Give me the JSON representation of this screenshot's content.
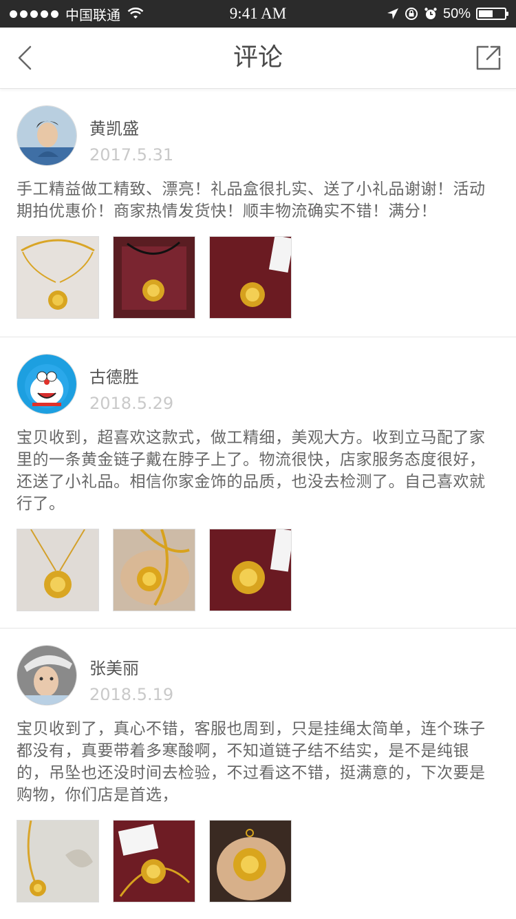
{
  "status_bar": {
    "carrier": "中国联通",
    "time": "9:41 AM",
    "battery": "50%",
    "battery_level": 0.5
  },
  "nav": {
    "title": "评论"
  },
  "reviews": [
    {
      "name": "黄凯盛",
      "date": "2017.5.31",
      "text": "手工精益做工精致、漂亮！礼品盒很扎实、送了小礼品谢谢！活动期拍优惠价！商家热情发货快！顺丰物流确实不错！满分！",
      "photos": [
        "gold-bangle-pendant",
        "pendant-in-gift-box",
        "pendant-with-tag"
      ]
    },
    {
      "name": "古德胜",
      "date": "2018.5.29",
      "text": "宝贝收到，超喜欢这款式，做工精细，美观大方。收到立马配了家里的一条黄金链子戴在脖子上了。物流很快，店家服务态度很好，还送了小礼品。相信你家金饰的品质，也没去检测了。自己喜欢就行了。",
      "photos": [
        "pendant-on-chain",
        "pendant-in-hand",
        "pendant-in-red-box"
      ]
    },
    {
      "name": "张美丽",
      "date": "2018.5.19",
      "text": "宝贝收到了，真心不错，客服也周到，只是挂绳太简单，连个珠子都没有，真要带着多寒酸啊，不知道链子结不结实，是不是纯银的，吊坠也还没时间去检验，不过看这不错，挺满意的，下次要是购物，你们店是首选，",
      "photos": [
        "pendant-on-chain-plant",
        "pendant-box-with-tag",
        "pendant-in-palm"
      ]
    }
  ]
}
